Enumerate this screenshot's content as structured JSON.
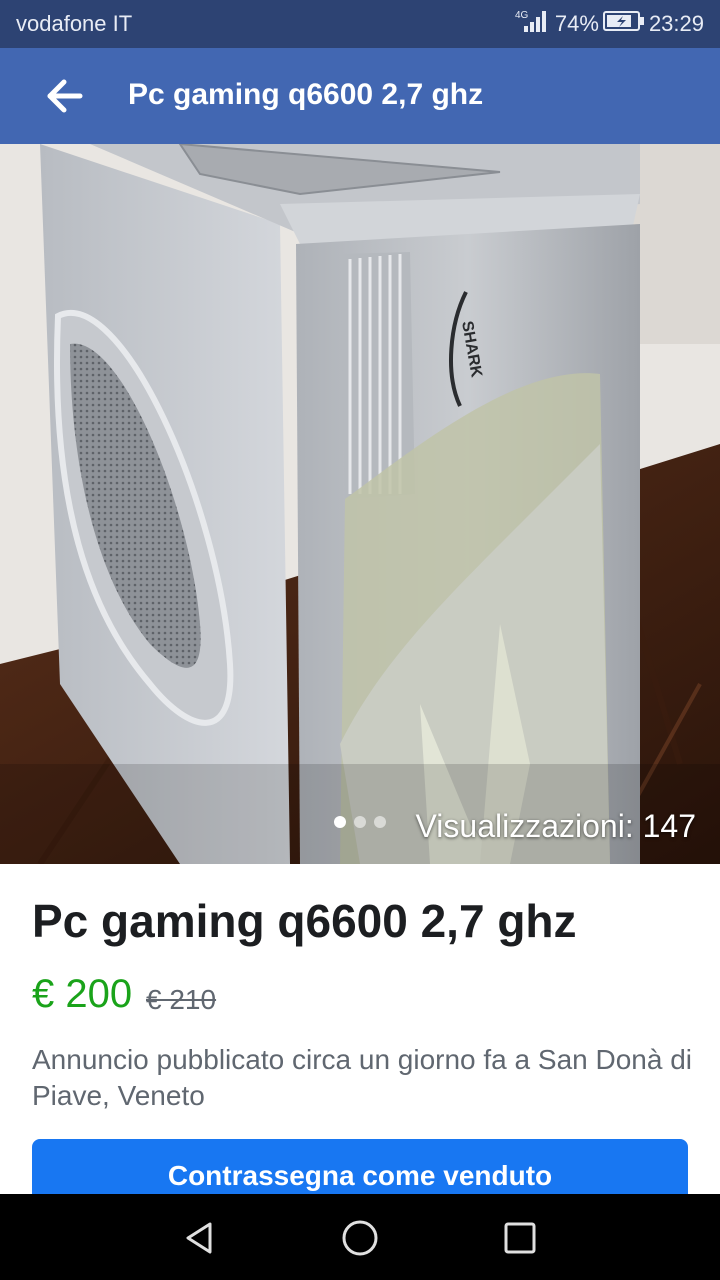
{
  "status_bar": {
    "carrier": "vodafone IT",
    "network": "4G",
    "battery": "74%",
    "time": "23:29",
    "icons": [
      "signal-icon",
      "battery-charging-icon"
    ]
  },
  "app_bar": {
    "title": "Pc gaming q6600 2,7 ghz",
    "back_icon": "arrow-left-icon"
  },
  "gallery": {
    "image": "computer-case-photo",
    "case_brand_text": "SHARK",
    "views_label": "Visualizzazioni: 147",
    "page_count": 3,
    "active_page": 1
  },
  "listing": {
    "title": "Pc gaming q6600 2,7 ghz",
    "price": "€ 200",
    "old_price": "€ 210",
    "posted": "Annuncio pubblicato circa un giorno fa a San Donà di Piave, Veneto",
    "mark_sold_label": "Contrassegna come venduto"
  },
  "colors": {
    "status_bar": "#2d4373",
    "app_bar": "#4267b2",
    "price": "#1aa31a",
    "button": "#1877f2",
    "nav_bar": "#000000"
  },
  "nav_bar": {
    "icons": [
      "back-triangle-icon",
      "home-circle-icon",
      "recents-square-icon"
    ]
  }
}
